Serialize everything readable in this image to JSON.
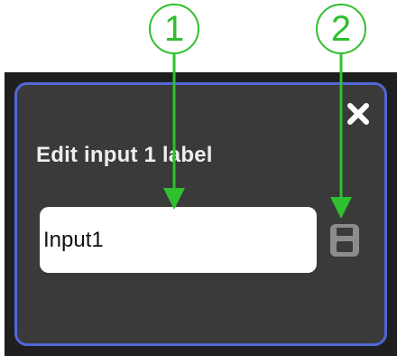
{
  "dialog": {
    "title": "Edit input 1 label",
    "input": {
      "value": "Input1",
      "placeholder": ""
    },
    "close_icon": "close-icon",
    "save_icon": "save-icon"
  },
  "annotations": {
    "callout_1": "1",
    "callout_2": "2",
    "color": "#2fbf2f"
  },
  "colors": {
    "dialog_border": "#5166d6",
    "dialog_bg": "#3a3a3a",
    "backdrop": "#1f1f1f"
  }
}
